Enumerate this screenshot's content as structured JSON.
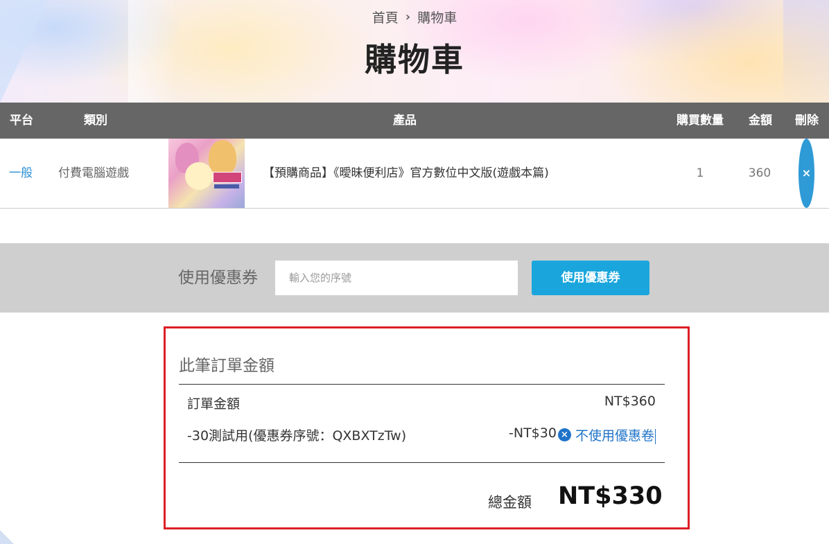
{
  "breadcrumb": {
    "home": "首頁",
    "current": "購物車"
  },
  "page_title": "購物車",
  "table": {
    "headers": {
      "platform": "平台",
      "category": "類別",
      "product": "產品",
      "quantity": "購買數量",
      "amount": "金額",
      "delete": "刪除"
    },
    "rows": [
      {
        "platform": "一般",
        "category": "付費電腦遊戲",
        "product": "【預購商品】《曖昧便利店》官方數位中文版(遊戲本篇)",
        "quantity": "1",
        "amount": "360",
        "delete_icon": "times-circle-icon"
      }
    ]
  },
  "coupon": {
    "label": "使用優惠券",
    "placeholder": "輸入您的序號",
    "value": "",
    "button": "使用優惠券"
  },
  "summary": {
    "title": "此筆訂單金額",
    "order_label": "訂單金額",
    "order_value": "NT$360",
    "discount_label": "-30測試用(優惠券序號：QXBXTzTw)",
    "discount_value": "-NT$30",
    "cancel_icon": "times-circle-icon",
    "cancel_label": "不使用優惠卷",
    "total_label": "總金額",
    "total_value": "NT$330"
  },
  "colors": {
    "header_bg": "#666666",
    "accent_blue": "#1aa6dd",
    "link_blue": "#1f73c9",
    "highlight_border": "#dc1f26",
    "coupon_bar_bg": "#cfcfcf"
  }
}
